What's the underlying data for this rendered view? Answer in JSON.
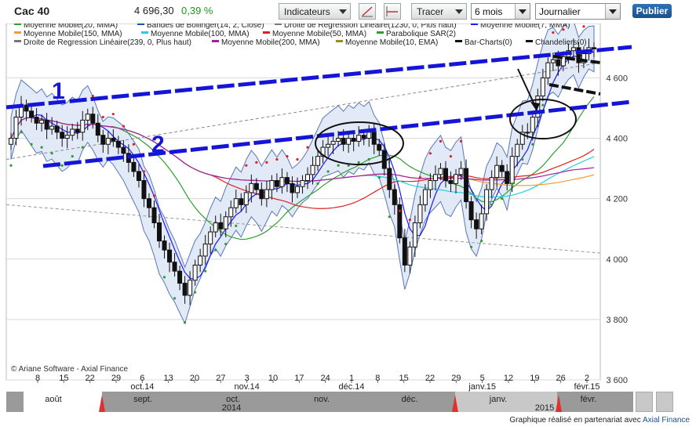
{
  "header": {
    "symbol": "Cac 40",
    "last_price": "4 696,30",
    "change_pct": "0,39 %",
    "indicators_label": "Indicateurs",
    "draw_label": "Tracer",
    "period_value": "6 mois",
    "interval_value": "Journalier",
    "publish_label": "Publier"
  },
  "legend": [
    {
      "text": "Moyenne Mobile(20, MMA)",
      "color": "#2e9e2e"
    },
    {
      "text": "Bandes de Bollinger(14, 2, Close)",
      "color": "#1f4fa8"
    },
    {
      "text": "Droite de Regression Linéaire(1230, 0, Plus haut)",
      "color": "#777777"
    },
    {
      "text": "Moyenne Mobile(7, MMA)",
      "color": "#1a1aff"
    },
    {
      "text": "Moyenne Mobile(150, MMA)",
      "color": "#f0a030"
    },
    {
      "text": "Moyenne Mobile(100, MMA)",
      "color": "#20d0e0"
    },
    {
      "text": "Moyenne Mobile(50, MMA)",
      "color": "#e02020"
    },
    {
      "text": "Parabolique SAR(2)",
      "color": "#2e9e2e"
    },
    {
      "text": "Droite de Regression Linéaire(239, 0, Plus haut)",
      "color": "#777777"
    },
    {
      "text": "Moyenne Mobile(200, MMA)",
      "color": "#a020a0"
    },
    {
      "text": "Moyenne Mobile(10, EMA)",
      "color": "#9a8a20"
    },
    {
      "text": "Bar-Charts(0)",
      "color": "#111111"
    },
    {
      "text": "Chandeliers(0)",
      "color": "#111111"
    }
  ],
  "annotations": {
    "label_1": "1",
    "label_2": "2"
  },
  "copyright": "© Ariane Software - Axial Finance",
  "credit": {
    "text": "Graphique réalisé en partenariat avec ",
    "link": "Axial Finance"
  },
  "chart_data": {
    "type": "candlestick",
    "ylim": [
      3600,
      4780
    ],
    "y_ticks": [
      "4 600",
      "4 400",
      "4 200",
      "4 000",
      "3 800",
      "3 600"
    ],
    "y_tick_values": [
      4600,
      4400,
      4200,
      4000,
      3800,
      3600
    ],
    "x_tick_days": [
      "8",
      "15",
      "22",
      "29",
      "6",
      "13",
      "20",
      "27",
      "3",
      "10",
      "17",
      "24",
      "1",
      "8",
      "15",
      "22",
      "29",
      "5",
      "12",
      "19",
      "26",
      "2"
    ],
    "x_month_labels": [
      {
        "text": "oct.14",
        "at_tick": 4
      },
      {
        "text": "nov.14",
        "at_tick": 8
      },
      {
        "text": "déc.14",
        "at_tick": 12
      },
      {
        "text": "janv.15",
        "at_tick": 17
      },
      {
        "text": "févr.15",
        "at_tick": 21
      }
    ],
    "navigator_months": [
      "août",
      "sept.",
      "oct.",
      "nov.",
      "déc.",
      "janv.",
      "févr."
    ],
    "navigator_years": [
      "2014",
      "2015"
    ],
    "closes": [
      4400,
      4470,
      4510,
      4490,
      4470,
      4450,
      4460,
      4430,
      4440,
      4420,
      4400,
      4410,
      4430,
      4420,
      4460,
      4480,
      4450,
      4410,
      4380,
      4400,
      4390,
      4370,
      4350,
      4320,
      4290,
      4260,
      4200,
      4170,
      4120,
      4060,
      4030,
      3990,
      3960,
      3920,
      3880,
      3930,
      3980,
      4010,
      4050,
      4090,
      4120,
      4100,
      4140,
      4170,
      4200,
      4180,
      4220,
      4250,
      4230,
      4200,
      4230,
      4260,
      4240,
      4270,
      4250,
      4220,
      4240,
      4260,
      4280,
      4310,
      4340,
      4370,
      4380,
      4390,
      4400,
      4380,
      4400,
      4390,
      4410,
      4400,
      4420,
      4380,
      4360,
      4300,
      4230,
      4180,
      4070,
      3980,
      4040,
      4120,
      4180,
      4230,
      4260,
      4280,
      4300,
      4260,
      4250,
      4280,
      4300,
      4190,
      4130,
      4100,
      4150,
      4230,
      4270,
      4310,
      4290,
      4250,
      4340,
      4380,
      4420,
      4420,
      4470,
      4540,
      4600,
      4650,
      4660,
      4640,
      4670,
      4690,
      4700,
      4650,
      4680,
      4700,
      4696
    ]
  }
}
